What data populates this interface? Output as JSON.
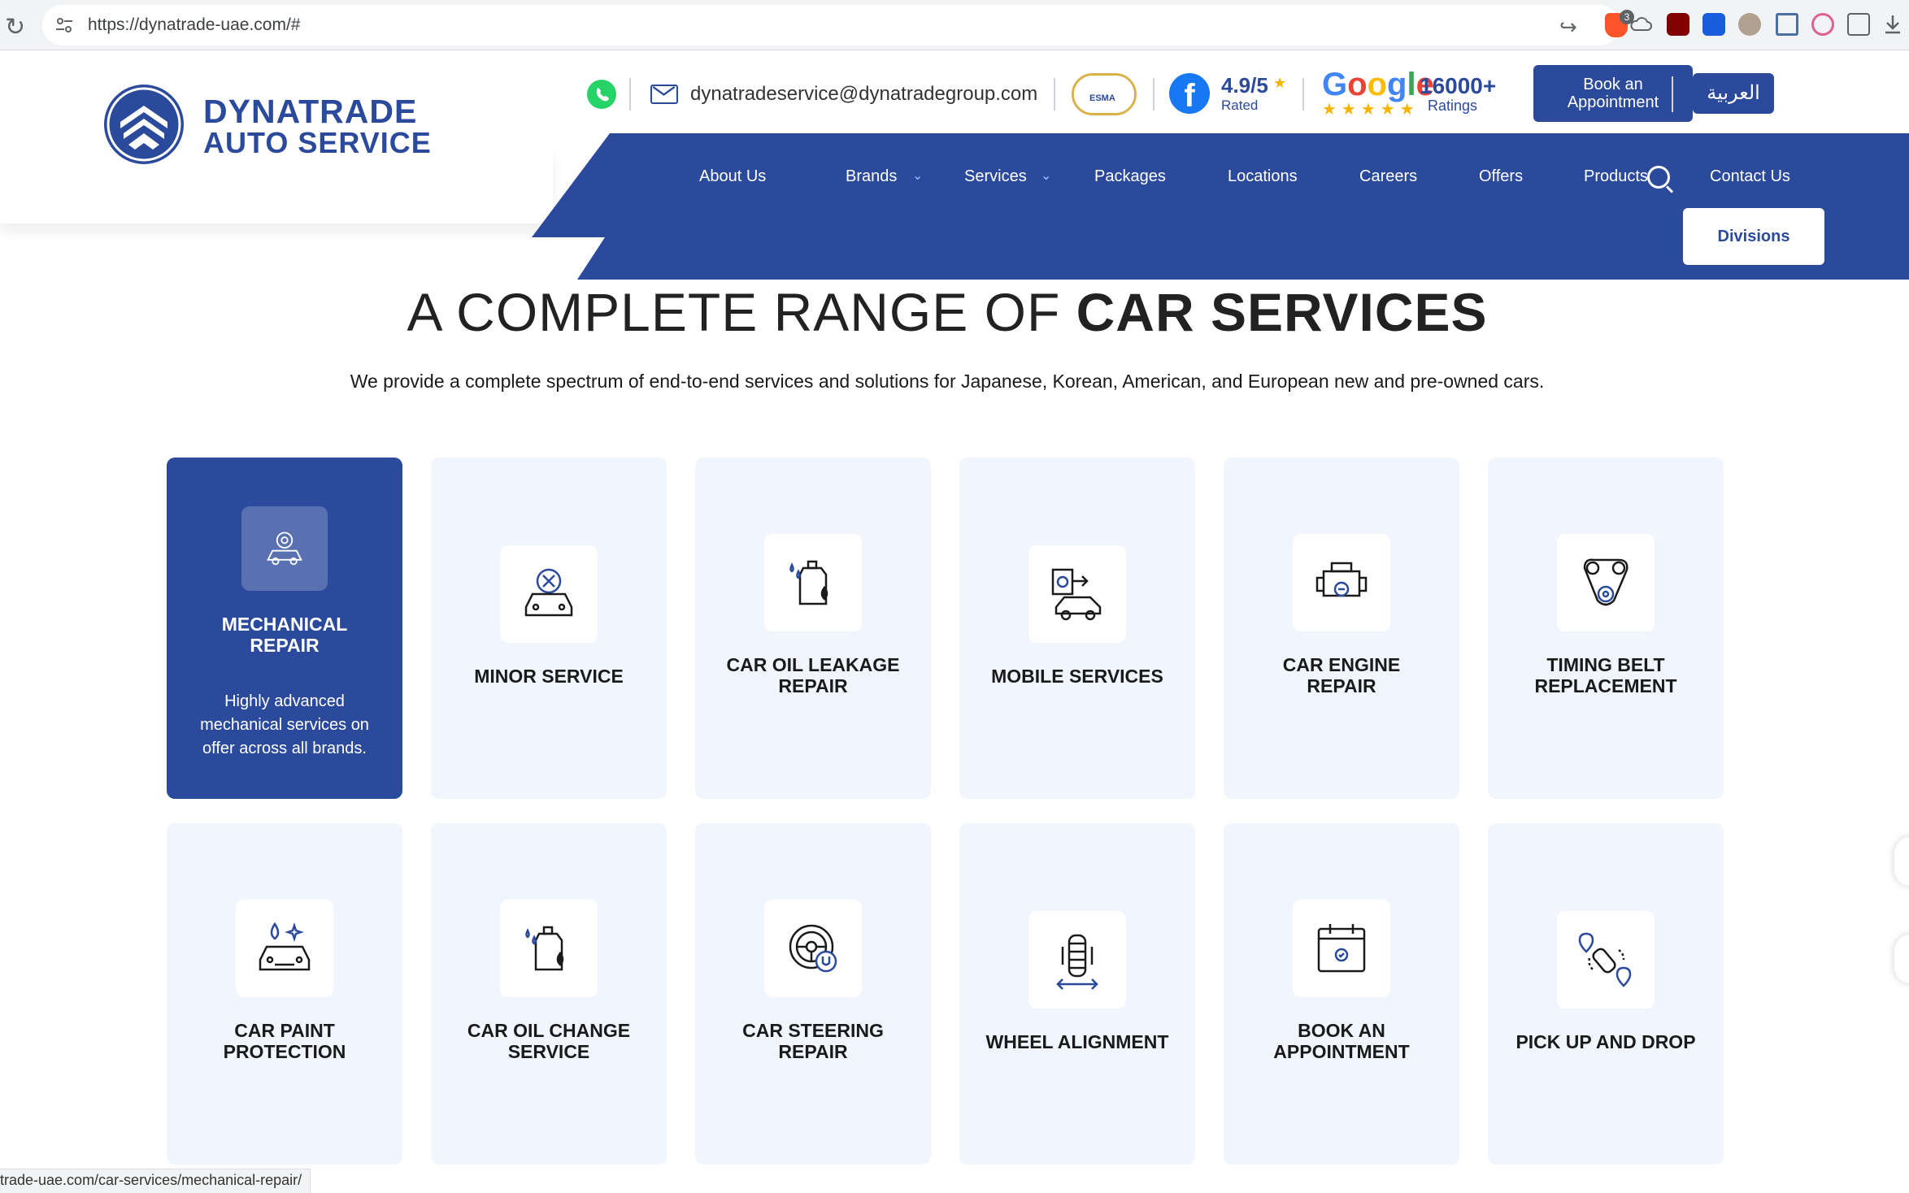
{
  "browser": {
    "url": "https://dynatrade-uae.com/#",
    "status_url": "trade-uae.com/car-services/mechanical-repair/",
    "brave_badge": "3"
  },
  "header": {
    "logo_line1": "DYNATRADE",
    "logo_line2": "AUTO SERVICE",
    "email": "dynatradeservice@dynatradegroup.com",
    "esma_label": "ESMA",
    "facebook_rating": "4.9/5",
    "facebook_rated": "Rated",
    "google_word": "Google",
    "google_count": "16000+",
    "google_ratings": "Ratings",
    "book_button": [
      "Book an",
      "Appointment"
    ],
    "arabic_button": "العربية"
  },
  "nav": {
    "items": [
      {
        "label": "About Us"
      },
      {
        "label": "Brands"
      },
      {
        "label": "Services"
      },
      {
        "label": "Packages"
      },
      {
        "label": "Locations"
      },
      {
        "label": "Careers"
      },
      {
        "label": "Offers"
      },
      {
        "label": "Products"
      },
      {
        "label": "Contact Us"
      }
    ],
    "divisions_button": "Divisions"
  },
  "hero": {
    "title_regular": "A COMPLETE RANGE OF ",
    "title_bold": "CAR SERVICES",
    "subtitle": "We provide a complete spectrum of end-to-end services and solutions for Japanese, Korean, American, and European new and pre-owned cars."
  },
  "services": [
    {
      "title": [
        "MECHANICAL",
        "REPAIR"
      ],
      "description": "Highly advanced mechanical services on offer across all brands.",
      "icon": "mechanical-repair-icon",
      "active": true
    },
    {
      "title": [
        "MINOR SERVICE"
      ],
      "icon": "minor-service-icon"
    },
    {
      "title": [
        "CAR OIL LEAKAGE",
        "REPAIR"
      ],
      "icon": "oil-leakage-icon"
    },
    {
      "title": [
        "MOBILE SERVICES"
      ],
      "icon": "mobile-services-icon"
    },
    {
      "title": [
        "CAR ENGINE",
        "REPAIR"
      ],
      "icon": "engine-repair-icon"
    },
    {
      "title": [
        "TIMING BELT",
        "REPLACEMENT"
      ],
      "icon": "timing-belt-icon"
    },
    {
      "title": [
        "CAR PAINT",
        "PROTECTION"
      ],
      "icon": "paint-protection-icon"
    },
    {
      "title": [
        "CAR OIL CHANGE",
        "SERVICE"
      ],
      "icon": "oil-change-icon"
    },
    {
      "title": [
        "CAR STEERING",
        "REPAIR"
      ],
      "icon": "steering-repair-icon"
    },
    {
      "title": [
        "WHEEL ALIGNMENT"
      ],
      "icon": "wheel-alignment-icon"
    },
    {
      "title": [
        "BOOK AN",
        "APPOINTMENT"
      ],
      "icon": "calendar-icon"
    },
    {
      "title": [
        "PICK UP AND DROP"
      ],
      "icon": "pickup-drop-icon"
    }
  ],
  "colors": {
    "brand_blue": "#2b4a9c",
    "card_bg": "#f1f6fe",
    "whatsapp": "#25d366",
    "facebook": "#1877f2",
    "star": "#f4b400"
  }
}
